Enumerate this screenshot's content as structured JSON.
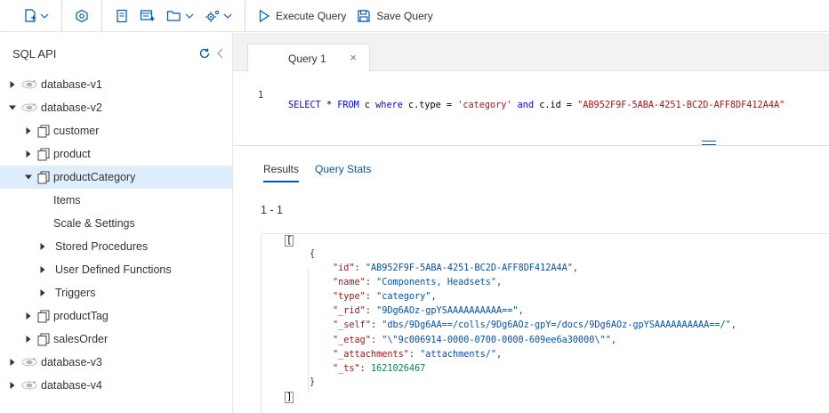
{
  "toolbar": {
    "execute_label": "Execute Query",
    "save_label": "Save Query"
  },
  "sidebar": {
    "title": "SQL API",
    "tree": [
      {
        "label": "database-v1",
        "type": "database",
        "expanded": false
      },
      {
        "label": "database-v2",
        "type": "database",
        "expanded": true
      },
      {
        "label": "customer",
        "type": "collection",
        "expanded": false
      },
      {
        "label": "product",
        "type": "collection",
        "expanded": false
      },
      {
        "label": "productCategory",
        "type": "collection",
        "expanded": true,
        "selected": true
      },
      {
        "label": "Items",
        "type": "leaf"
      },
      {
        "label": "Scale & Settings",
        "type": "leaf"
      },
      {
        "label": "Stored Procedures",
        "type": "group"
      },
      {
        "label": "User Defined Functions",
        "type": "group"
      },
      {
        "label": "Triggers",
        "type": "group"
      },
      {
        "label": "productTag",
        "type": "collection",
        "expanded": false
      },
      {
        "label": "salesOrder",
        "type": "collection",
        "expanded": false
      },
      {
        "label": "database-v3",
        "type": "database",
        "expanded": false
      },
      {
        "label": "database-v4",
        "type": "database",
        "expanded": false
      }
    ]
  },
  "main": {
    "tab_label": "Query 1",
    "tab_close": "×",
    "editor": {
      "line_number": "1",
      "tokens": [
        {
          "t": "kw",
          "v": "SELECT"
        },
        {
          "t": "pl",
          "v": " * "
        },
        {
          "t": "kw",
          "v": "FROM"
        },
        {
          "t": "pl",
          "v": " c "
        },
        {
          "t": "kw",
          "v": "where"
        },
        {
          "t": "pl",
          "v": " c.type = "
        },
        {
          "t": "str",
          "v": "'category'"
        },
        {
          "t": "pl",
          "v": " "
        },
        {
          "t": "kw",
          "v": "and"
        },
        {
          "t": "pl",
          "v": " c.id = "
        },
        {
          "t": "str",
          "v": "\"AB952F9F-5ABA-4251-BC2D-AFF8DF412A4A\""
        }
      ]
    },
    "result_tabs": {
      "results": "Results",
      "stats": "Query Stats"
    },
    "range": "1 - 1",
    "json": {
      "open_array": "[",
      "open_obj": "{",
      "fields": [
        {
          "key": "\"id\"",
          "value": "\"AB952F9F-5ABA-4251-BC2D-AFF8DF412A4A\"",
          "kind": "string",
          "comma": ","
        },
        {
          "key": "\"name\"",
          "value": "\"Components, Headsets\"",
          "kind": "string",
          "comma": ","
        },
        {
          "key": "\"type\"",
          "value": "\"category\"",
          "kind": "string",
          "comma": ","
        },
        {
          "key": "\"_rid\"",
          "value": "\"9Dg6AOz-gpYSAAAAAAAAAA==\"",
          "kind": "string",
          "comma": ","
        },
        {
          "key": "\"_self\"",
          "value": "\"dbs/9Dg6AA==/colls/9Dg6AOz-gpY=/docs/9Dg6AOz-gpYSAAAAAAAAAA==/\"",
          "kind": "string",
          "comma": ","
        },
        {
          "key": "\"_etag\"",
          "value": "\"\\\"9c006914-0000-0700-0000-609ee6a30000\\\"\"",
          "kind": "string",
          "comma": ","
        },
        {
          "key": "\"_attachments\"",
          "value": "\"attachments/\"",
          "kind": "string",
          "comma": ","
        },
        {
          "key": "\"_ts\"",
          "value": "1621026467",
          "kind": "number",
          "comma": ""
        }
      ],
      "close_obj": "}",
      "close_array": "]"
    }
  }
}
